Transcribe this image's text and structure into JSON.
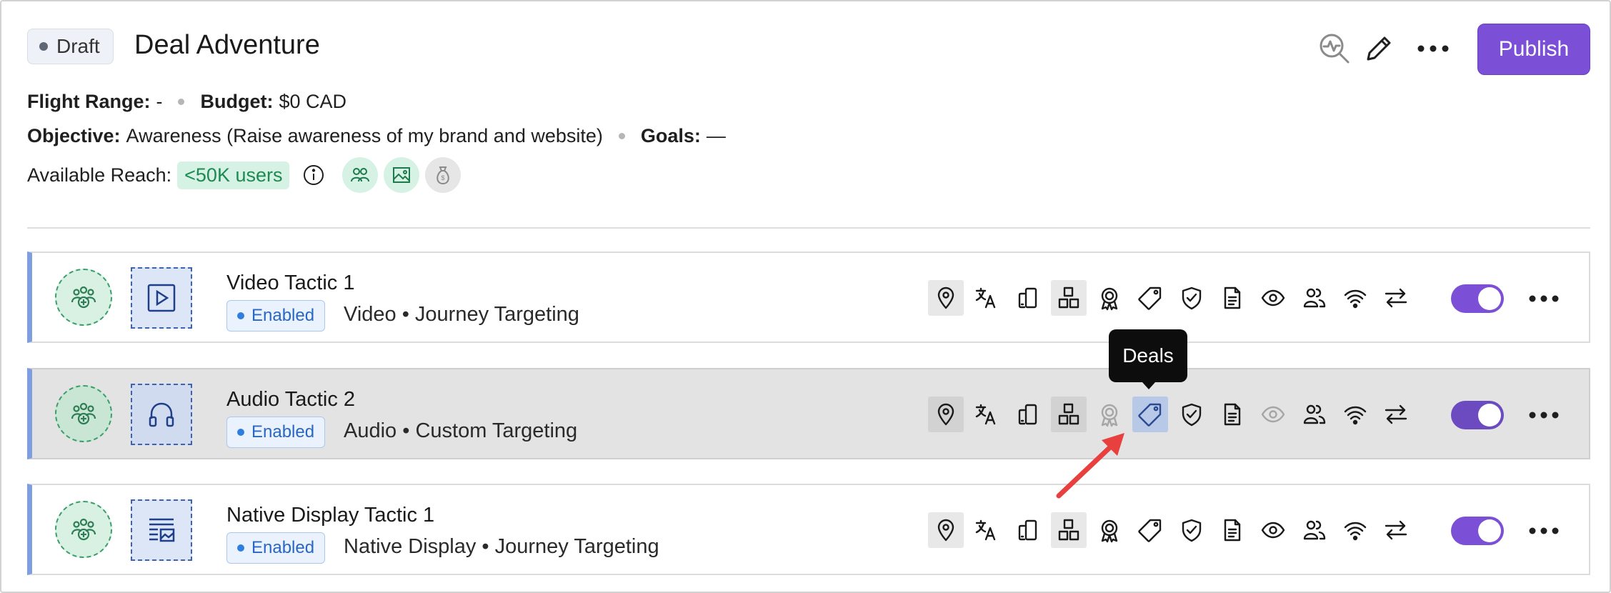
{
  "header": {
    "status": "Draft",
    "title": "Deal Adventure",
    "publish_label": "Publish",
    "icons": [
      "analytics-search-icon",
      "pencil-icon",
      "more-horizontal-icon"
    ]
  },
  "meta": {
    "flight_range_label": "Flight Range:",
    "flight_range_value": "-",
    "budget_label": "Budget:",
    "budget_value": "$0 CAD",
    "objective_label": "Objective:",
    "objective_value": "Awareness (Raise awareness of my brand and website)",
    "goals_label": "Goals:",
    "goals_value": "—",
    "reach_label": "Available Reach:",
    "reach_value": "<50K users",
    "reach_icons": [
      "audience-icon",
      "image-icon",
      "money-bag-icon"
    ]
  },
  "tactics": [
    {
      "name": "Video Tactic 1",
      "status": "Enabled",
      "description": "Video • Journey Targeting",
      "creative_icon": "video-play-icon",
      "enabled": true
    },
    {
      "name": "Audio Tactic 2",
      "status": "Enabled",
      "description": "Audio • Custom Targeting",
      "creative_icon": "headphones-icon",
      "enabled": true
    },
    {
      "name": "Native Display Tactic 1",
      "status": "Enabled",
      "description": "Native Display • Journey Targeting",
      "creative_icon": "native-display-icon",
      "enabled": true
    }
  ],
  "targeting_icons": [
    "location-pin-icon",
    "language-icon",
    "devices-icon",
    "inventory-blocks-icon",
    "award-badge-icon",
    "deals-tag-icon",
    "brand-safety-shield-icon",
    "document-icon",
    "eye-icon",
    "audience-people-icon",
    "wifi-signal-icon",
    "swap-arrows-icon"
  ],
  "tooltip": {
    "text": "Deals"
  },
  "colors": {
    "accent": "#7b4fd6",
    "enabled_blue": "#2f7de1",
    "reach_green": "#1e8a52",
    "annotation_red": "#e8403f"
  }
}
